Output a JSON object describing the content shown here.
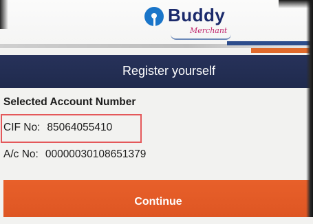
{
  "header": {
    "logo_text": "Buddy",
    "logo_subtext": "Merchant"
  },
  "titlebar": {
    "title": "Register yourself"
  },
  "content": {
    "section_title": "Selected Account Number",
    "cif": {
      "label": "CIF No:",
      "value": "85064055410"
    },
    "account": {
      "label": "A/c No:",
      "value": "00000030108651379"
    }
  },
  "actions": {
    "continue_label": "Continue"
  },
  "colors": {
    "title_bar": "#222d52",
    "button": "#e15b27",
    "highlight_box": "#e4585a",
    "logo_blue": "#1a75c9",
    "logo_text": "#1b2a6b",
    "logo_sub": "#c0266d"
  },
  "icons": {
    "logo": "sbi-keyhole-logo-icon"
  }
}
